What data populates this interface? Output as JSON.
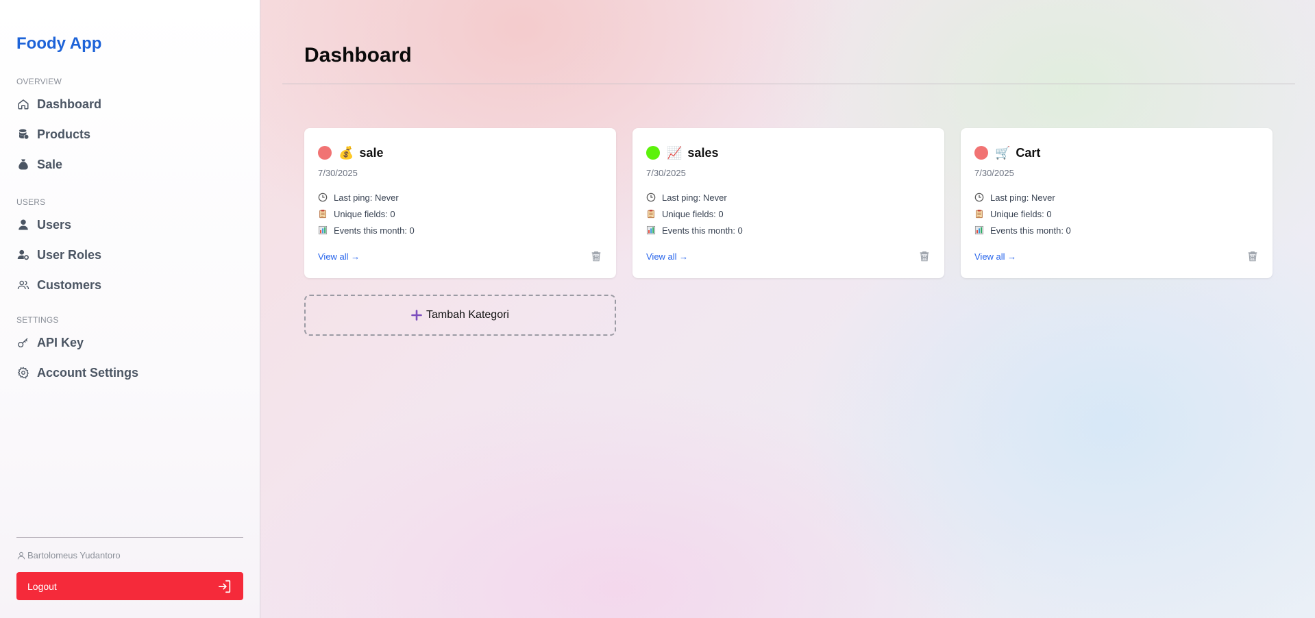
{
  "app": {
    "title": "Foody App"
  },
  "sidebar": {
    "sections": [
      {
        "label": "OVERVIEW",
        "items": [
          {
            "label": "Dashboard",
            "icon": "home-icon"
          },
          {
            "label": "Products",
            "icon": "database-icon"
          },
          {
            "label": "Sale",
            "icon": "money-bag-icon"
          }
        ]
      },
      {
        "label": "USERS",
        "items": [
          {
            "label": "Users",
            "icon": "user-icon"
          },
          {
            "label": "User Roles",
            "icon": "user-gear-icon"
          },
          {
            "label": "Customers",
            "icon": "users-icon"
          }
        ]
      },
      {
        "label": "SETTINGS",
        "items": [
          {
            "label": "API Key",
            "icon": "key-icon"
          },
          {
            "label": "Account Settings",
            "icon": "gear-icon"
          }
        ]
      }
    ],
    "user": "Bartolomeus Yudantoro",
    "logout_label": "Logout"
  },
  "main": {
    "title": "Dashboard",
    "cards": [
      {
        "emoji": "💰",
        "name": "sale",
        "date": "7/30/2025",
        "status_color": "#f17373",
        "last_ping": "Last ping: Never",
        "unique_fields": "Unique fields: 0",
        "events": "Events this month: 0",
        "view_all": "View all →"
      },
      {
        "emoji": "📈",
        "name": "sales",
        "date": "7/30/2025",
        "status_color": "#5cf20b",
        "last_ping": "Last ping: Never",
        "unique_fields": "Unique fields: 0",
        "events": "Events this month: 0",
        "view_all": "View all →"
      },
      {
        "emoji": "🛒",
        "name": "Cart",
        "date": "7/30/2025",
        "status_color": "#f17373",
        "last_ping": "Last ping: Never",
        "unique_fields": "Unique fields: 0",
        "events": "Events this month: 0",
        "view_all": "View all →"
      }
    ],
    "add_category_label": "Tambah Kategori"
  },
  "colors": {
    "brand": "#1d63d8",
    "logout": "#f52a3a",
    "link": "#2563eb",
    "plus": "#7c4dbd"
  }
}
